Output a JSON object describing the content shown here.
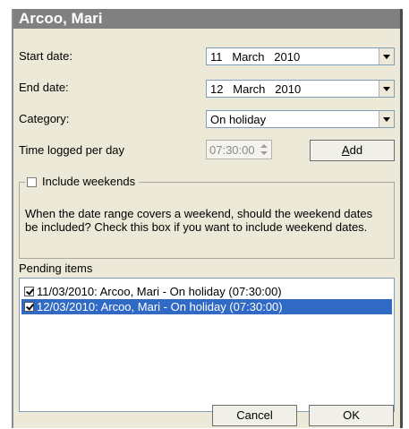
{
  "dialog": {
    "title": "Arcoo, Mari",
    "start_date": {
      "label": "Start date:",
      "value": "11   March   2010"
    },
    "end_date": {
      "label": "End date:",
      "value": "12   March   2010"
    },
    "category": {
      "label": "Category:",
      "value": "On holiday"
    },
    "time_logged": {
      "label": "Time logged per day",
      "value": "07:30:00"
    },
    "add_button": {
      "accel": "A",
      "rest": "dd"
    },
    "include_weekends": {
      "label": "Include weekends",
      "checked": false,
      "description": "When the date range covers a weekend, should the weekend dates be included?  Check this box if you want to include weekend dates."
    },
    "pending": {
      "label": "Pending items",
      "items": [
        {
          "text": "11/03/2010: Arcoo, Mari - On holiday (07:30:00)",
          "checked": true,
          "selected": false
        },
        {
          "text": "12/03/2010: Arcoo, Mari - On holiday (07:30:00)",
          "checked": true,
          "selected": true
        }
      ]
    },
    "cancel_label": "Cancel",
    "ok_label": "OK"
  }
}
